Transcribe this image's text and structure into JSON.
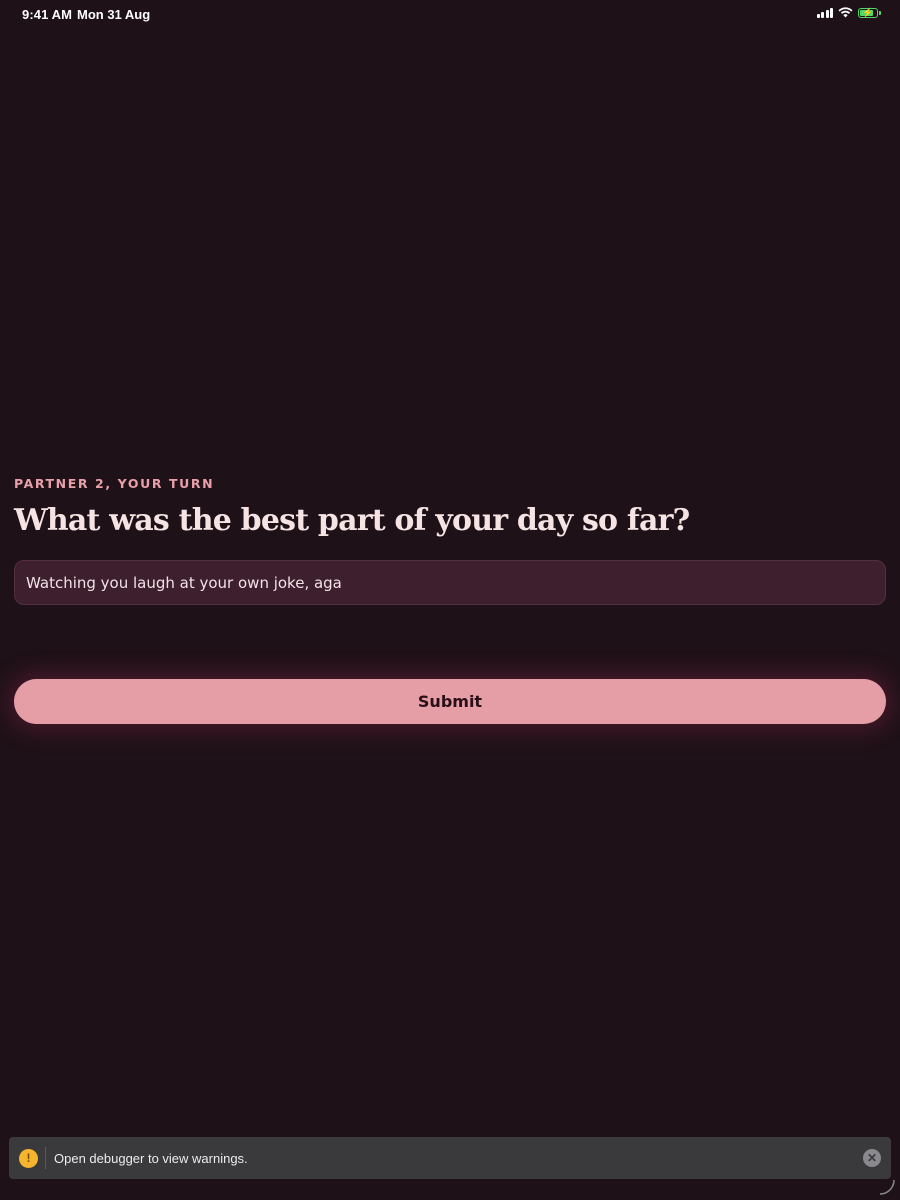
{
  "status_bar": {
    "time": "9:41 AM",
    "date": "Mon 31 Aug",
    "icons": [
      "cellular-signal-icon",
      "wifi-icon",
      "battery-charging-icon"
    ],
    "battery_color": "#4cd964"
  },
  "prompt": {
    "turn_label": "PARTNER 2, YOUR TURN",
    "question": "What was the best part of your day so far?"
  },
  "answer": {
    "value": "Watching you laugh at your own joke, aga"
  },
  "submit": {
    "label": "Submit"
  },
  "debug_toast": {
    "message": "Open debugger to view warnings.",
    "warning_symbol": "!",
    "close_symbol": "✕"
  },
  "colors": {
    "background": "#1f1118",
    "accent": "#e69ea6",
    "label": "#e8a0aa",
    "heading": "#f6e4e4",
    "input_background": "#3d1f2d"
  }
}
